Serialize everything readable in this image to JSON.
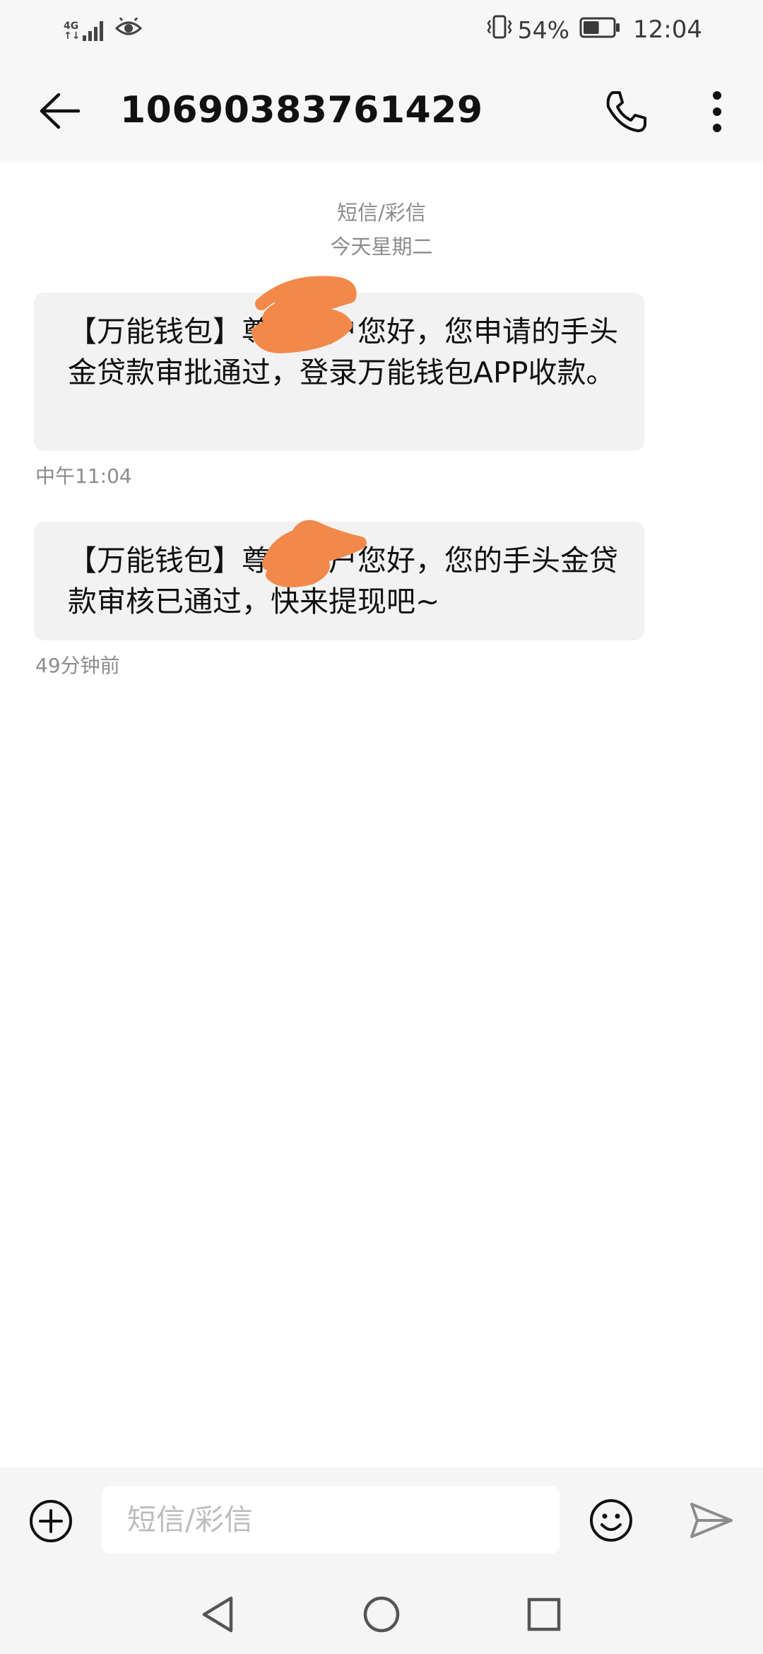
{
  "status_bar": {
    "signal_label_top": "4G",
    "signal_label_bottom": "↑↓",
    "battery_percent": "54%",
    "battery_level": 0.54,
    "time": "12:04",
    "icons": [
      "signal-icon",
      "eye-icon",
      "vibrate-icon",
      "battery-icon"
    ]
  },
  "header": {
    "title": "10690383761429",
    "icons": [
      "back-arrow-icon",
      "phone-icon",
      "more-vert-icon"
    ]
  },
  "thread": {
    "type_label": "短信/彩信",
    "date_label": "今天星期二",
    "messages": [
      {
        "text": "【万能钱包】尊敬用户您好，您申请的手头金贷款审批通过，登录万能钱包APP收款。",
        "time": "中午11:04"
      },
      {
        "text": "【万能钱包】尊敬用户您好，您的手头金贷款审核已通过，快来提现吧~",
        "time": "49分钟前"
      }
    ],
    "redaction_color": "#f2894a"
  },
  "composer": {
    "placeholder": "短信/彩信",
    "icons": [
      "add-circle-icon",
      "emoji-icon",
      "send-icon"
    ]
  },
  "nav_bar": {
    "icons": [
      "nav-back-icon",
      "nav-home-icon",
      "nav-recents-icon"
    ]
  }
}
